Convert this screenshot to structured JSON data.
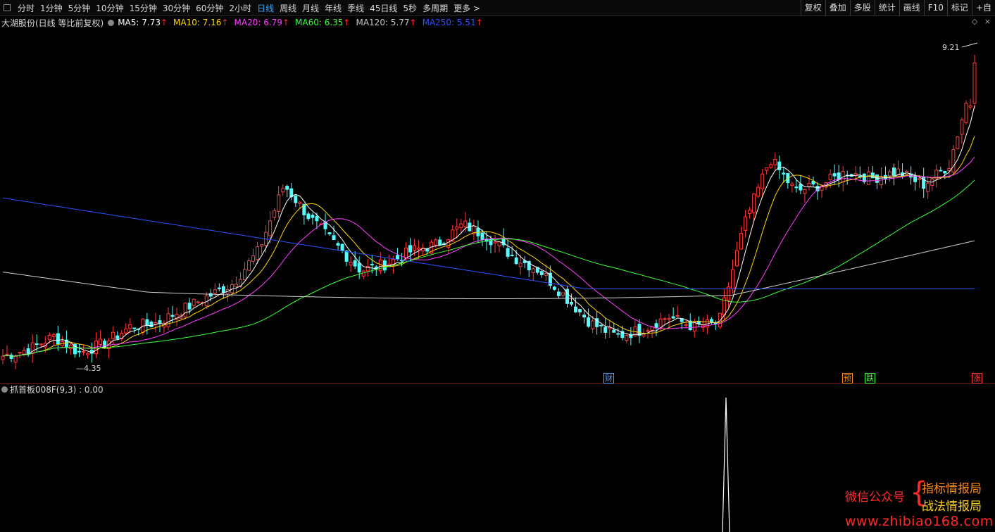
{
  "toolbar": {
    "periods": [
      "分时",
      "1分钟",
      "5分钟",
      "10分钟",
      "15分钟",
      "30分钟",
      "60分钟",
      "2小时",
      "日线",
      "周线",
      "月线",
      "年线",
      "季线",
      "45日线",
      "5秒",
      "多周期",
      "更多 >"
    ],
    "active_period": "日线",
    "tools": [
      "复权",
      "叠加",
      "多股",
      "统计",
      "画线",
      "F10",
      "标记",
      "+自"
    ]
  },
  "legend": {
    "title": "大湖股份(日线 等比前复权)",
    "ma": [
      {
        "label": "MA5: 7.73",
        "color": "#ffffff"
      },
      {
        "label": "MA10: 7.16",
        "color": "#ffd700"
      },
      {
        "label": "MA20: 6.79",
        "color": "#ff40ff"
      },
      {
        "label": "MA60: 6.35",
        "color": "#40ff40"
      },
      {
        "label": "MA120: 5.77",
        "color": "#c8c8c8"
      },
      {
        "label": "MA250: 5.51",
        "color": "#3050ff"
      }
    ],
    "up_arrow": "↑"
  },
  "chart": {
    "high_label": "9.21",
    "low_label": "4.35",
    "colors": {
      "up": "#ff3b3b",
      "down": "#54ffff",
      "ma5": "#ffffff",
      "ma10": "#ffd700",
      "ma20": "#ff40ff",
      "ma60": "#40ff40",
      "ma120": "#d0d0d0",
      "ma250": "#3050ff"
    }
  },
  "markers": [
    {
      "label": "财",
      "color": "#54a0ff"
    },
    {
      "label": "预",
      "color": "#ff8c1a"
    },
    {
      "label": "跌",
      "color": "#40ff40"
    },
    {
      "label": "涨",
      "color": "#ff3b3b"
    }
  ],
  "indicator": {
    "label": "抓首板008F(9,3) : 0.00"
  },
  "watermark": {
    "left": "微信公众号",
    "brace": "{",
    "line1": "指标情报局",
    "line2": "战法情报局",
    "url": "www.zhibiao168.com"
  },
  "chart_data": {
    "type": "candlestick",
    "high": 9.21,
    "low": 4.35,
    "close_levels": [
      4.5,
      4.6,
      4.8,
      4.55,
      4.7,
      4.95,
      5.0,
      5.2,
      5.4,
      5.6,
      6.1,
      7.1,
      6.6,
      6.2,
      5.8,
      5.9,
      6.1,
      6.2,
      6.5,
      6.3,
      6.0,
      5.8,
      5.4,
      5.0,
      4.8,
      4.9,
      5.1,
      4.95,
      5.0,
      6.5,
      7.5,
      7.0,
      7.1,
      7.3,
      7.2,
      7.3,
      7.1,
      7.4,
      8.8
    ]
  }
}
